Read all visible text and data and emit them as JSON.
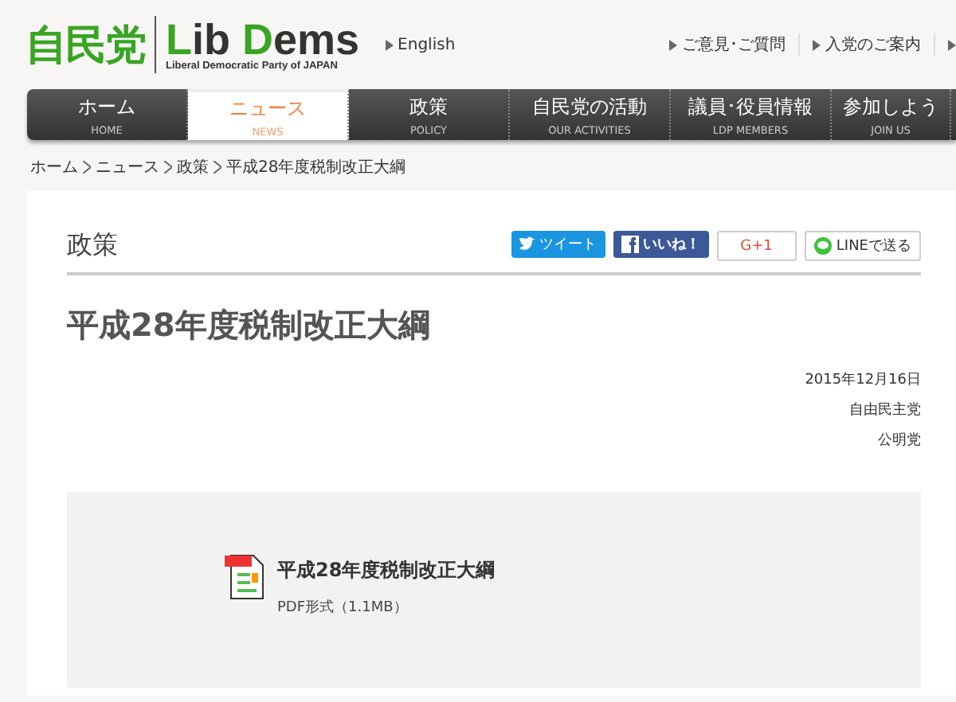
{
  "header": {
    "logo_jp": "自民党",
    "logo_en": "Lib Dems",
    "logo_sub": "Liberal Democratic Party of JAPAN",
    "language_link": "English",
    "links": [
      "ご意見･ご質問",
      "入党のご案内"
    ]
  },
  "nav": [
    {
      "label": "ホーム",
      "sub": "HOME",
      "selected": false
    },
    {
      "label": "ニュース",
      "sub": "NEWS",
      "selected": true
    },
    {
      "label": "政策",
      "sub": "POLICY",
      "selected": false
    },
    {
      "label": "自民党の活動",
      "sub": "OUR ACTIVITIES",
      "selected": false
    },
    {
      "label": "議員･役員情報",
      "sub": "LDP MEMBERS",
      "selected": false
    },
    {
      "label": "参加しよう",
      "sub": "JOIN US",
      "selected": false
    }
  ],
  "breadcrumb": [
    "ホーム",
    "ニュース",
    "政策",
    "平成28年度税制改正大綱"
  ],
  "section": "政策",
  "share": [
    {
      "kind": "tweet",
      "label": "ツイート"
    },
    {
      "kind": "like",
      "label": "いいね！"
    },
    {
      "kind": "plus",
      "label": "G+1"
    },
    {
      "kind": "line",
      "label": "LINEで送る"
    }
  ],
  "article": {
    "title": "平成28年度税制改正大綱",
    "meta": [
      "2015年12月16日",
      "自由民主党",
      "公明党"
    ]
  },
  "attachment": {
    "title": "平成28年度税制改正大綱",
    "info": "PDF形式（1.1MB）"
  }
}
